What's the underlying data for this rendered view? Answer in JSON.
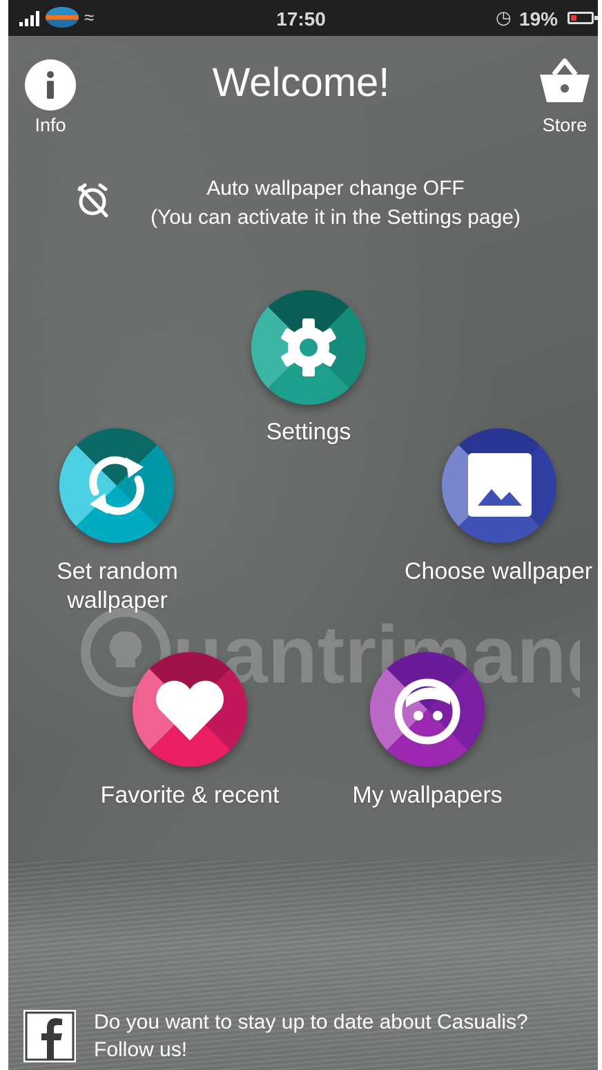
{
  "status_bar": {
    "time": "17:50",
    "battery_percent": "19%",
    "alarm_icon": "alarm-clock-icon",
    "wifi_icon": "wifi-icon",
    "signal_icon": "signal-icon",
    "battery_level": 0.19,
    "battery_color": "#e53935"
  },
  "header": {
    "title": "Welcome!",
    "info_label": "Info",
    "store_label": "Store",
    "info_icon": "info-icon",
    "store_icon": "basket-icon"
  },
  "notice": {
    "line1": "Auto wallpaper change OFF",
    "line2": "(You can activate it in the Settings page)",
    "icon": "alarm-off-icon"
  },
  "menu": {
    "settings": {
      "label": "Settings",
      "icon": "gear-icon",
      "color": "#1e9e8c"
    },
    "random": {
      "label": "Set random wallpaper",
      "icon": "refresh-icon",
      "color": "#00acc1"
    },
    "choose": {
      "label": "Choose wallpaper",
      "icon": "image-icon",
      "color": "#3f51b5"
    },
    "favorite": {
      "label": "Favorite & recent",
      "icon": "heart-icon",
      "color": "#e91e63"
    },
    "mywallpapers": {
      "label": "My wallpapers",
      "icon": "face-icon",
      "color": "#9c27b0"
    }
  },
  "watermark": {
    "text": "uantrimang"
  },
  "footer": {
    "line1": "Do you want to stay up to date about Casualis?",
    "line2": "Follow us!",
    "icon": "facebook-icon"
  }
}
